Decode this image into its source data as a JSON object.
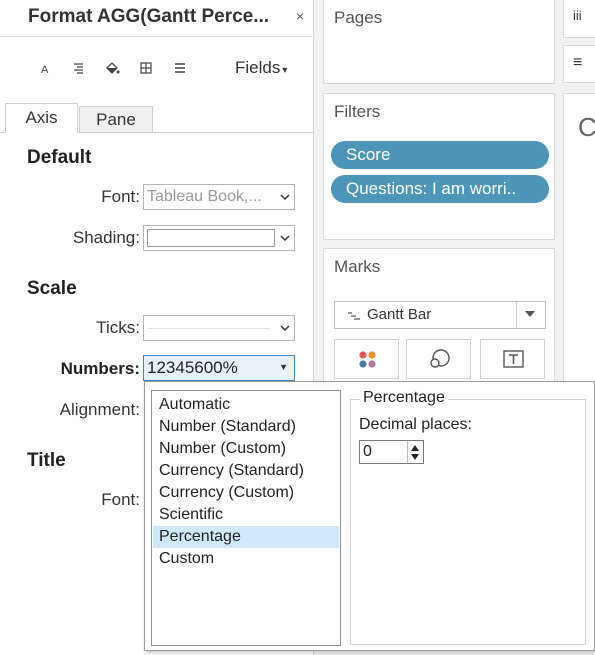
{
  "format_pane": {
    "title": "Format AGG(Gantt Perce...",
    "close_glyph": "×",
    "fields_label": "Fields",
    "tabs": {
      "axis": "Axis",
      "pane": "Pane"
    },
    "default": {
      "heading": "Default",
      "font_label": "Font:",
      "font_value": "Tableau Book,...",
      "shading_label": "Shading:"
    },
    "scale": {
      "heading": "Scale",
      "ticks_label": "Ticks:",
      "numbers_label": "Numbers:",
      "numbers_value": "12345600%",
      "alignment_label": "Alignment:"
    },
    "title_section": {
      "heading": "Title",
      "font_label": "Font:"
    }
  },
  "shelves": {
    "pages_title": "Pages",
    "filters_title": "Filters",
    "filters": [
      "Score",
      "Questions: I am worri.."
    ],
    "marks_title": "Marks",
    "mark_type": "Gantt Bar",
    "mark_buttons": [
      "color-icon",
      "size-icon",
      "label-icon"
    ],
    "right_strip_glyphs": [
      "iii",
      "≡"
    ],
    "canvas_partial_text": "C"
  },
  "number_popup": {
    "formats": [
      "Automatic",
      "Number (Standard)",
      "Number (Custom)",
      "Currency (Standard)",
      "Currency (Custom)",
      "Scientific",
      "Percentage",
      "Custom"
    ],
    "selected_format": "Percentage",
    "group_title": "Percentage",
    "decimal_label": "Decimal places:",
    "decimal_value": "0"
  },
  "colors": {
    "pill": "#4e96b8",
    "selection": "#cfe8fc",
    "numbers_focus": "#3a84c1"
  }
}
